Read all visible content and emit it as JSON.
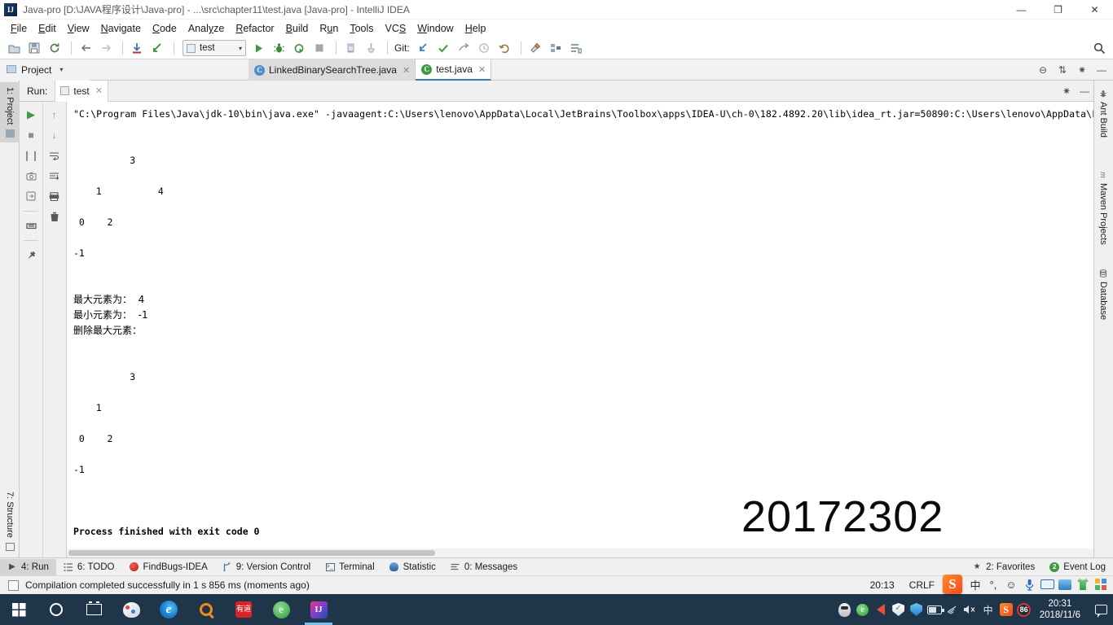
{
  "window": {
    "title": "Java-pro [D:\\JAVA程序设计\\Java-pro] - ...\\src\\chapter11\\test.java [Java-pro] - IntelliJ IDEA",
    "logo": "IJ",
    "buttons": {
      "minimize": "—",
      "maximize": "❐",
      "close": "✕"
    }
  },
  "menu": {
    "items": [
      {
        "label": "File",
        "accel": "F"
      },
      {
        "label": "Edit",
        "accel": "E"
      },
      {
        "label": "View",
        "accel": "V"
      },
      {
        "label": "Navigate",
        "accel": "N"
      },
      {
        "label": "Code",
        "accel": "C"
      },
      {
        "label": "Analyze",
        "accel": "y"
      },
      {
        "label": "Refactor",
        "accel": "R"
      },
      {
        "label": "Build",
        "accel": "B"
      },
      {
        "label": "Run",
        "accel": "u"
      },
      {
        "label": "Tools",
        "accel": "T"
      },
      {
        "label": "VCS",
        "accel": "S"
      },
      {
        "label": "Window",
        "accel": "W"
      },
      {
        "label": "Help",
        "accel": "H"
      }
    ]
  },
  "toolbar": {
    "open_icon": "open-project-icon",
    "save_icon": "save-all-icon",
    "sync_icon": "synchronize-icon",
    "back_icon": "◀",
    "forward_icon": "▶",
    "update_icon": "↓",
    "compile_icon": "◣",
    "run_config": "test",
    "run_icon": "▶",
    "debug_icon": "debug-icon",
    "coverage_icon": "coverage-icon",
    "stop_icon": "■",
    "profile_icon": "profile-icon",
    "attach_icon": "attach-icon",
    "git_label": "Git:",
    "git_update_icon": "↙",
    "git_commit_icon": "✓",
    "git_push_icon": "⤴",
    "git_history_icon": "◷",
    "git_revert_icon": "↺",
    "settings_icon": "⚒",
    "structure_icon": "structure-icon",
    "layout_icon": "layout-icon",
    "search_icon": "🔍"
  },
  "navrow": {
    "project_label": "Project",
    "caret": "▾",
    "collapse_icon": "⊖",
    "flatten_icon": "⇅",
    "gear_icon": "✷",
    "hide_icon": "—"
  },
  "editor_tabs": [
    {
      "label": "LinkedBinarySearchTree.java",
      "icon": "C",
      "close": "✕",
      "active": false
    },
    {
      "label": "test.java",
      "icon": "C",
      "close": "✕",
      "active": true
    }
  ],
  "left_stripe": {
    "top": {
      "label": "1: Project",
      "icon": "folder-icon"
    },
    "bottom": {
      "label": "7: Structure",
      "icon": "structure-icon"
    }
  },
  "right_stripe": [
    {
      "label": "Ant Build",
      "icon": "ant-icon"
    },
    {
      "label": "Maven Projects",
      "icon": "m"
    },
    {
      "label": "Database",
      "icon": "database-icon"
    }
  ],
  "run_window": {
    "label": "Run:",
    "tab": "test",
    "tab_close": "✕",
    "gear_icon": "✷",
    "hide_icon": "—",
    "side_icons_col1": [
      "rerun-icon",
      "stop-icon",
      "pause-icon",
      "thread-dump-icon",
      "restore-layout-icon",
      "print-icon",
      "pin-tab-icon"
    ],
    "side_icons_col2": [
      "up-stacktrace-icon",
      "down-stacktrace-icon",
      "soft-wrap-icon",
      "scroll-to-end-icon",
      "print-console-icon",
      "clear-all-icon"
    ]
  },
  "console": {
    "command_line": "\"C:\\Program Files\\Java\\jdk-10\\bin\\java.exe\" -javaagent:C:\\Users\\lenovo\\AppData\\Local\\JetBrains\\Toolbox\\apps\\IDEA-U\\ch-0\\182.4892.20\\lib\\idea_rt.jar=50890:C:\\Users\\lenovo\\AppData\\L",
    "tree_before": [
      "          3",
      "",
      "    1          4",
      "",
      " 0    2",
      "",
      "-1"
    ],
    "max_label": "最大元素为：",
    "max_value": "4",
    "min_label": "最小元素为：",
    "min_value": "-1",
    "remove_label": "删除最大元素：",
    "tree_after": [
      "          3",
      "",
      "    1",
      "",
      " 0    2",
      "",
      "-1"
    ],
    "exit_line": "Process finished with exit code 0",
    "watermark": "20172302"
  },
  "bottom_stripe": {
    "items": [
      {
        "label": "4: Run",
        "icon": "run-icon",
        "selected": true
      },
      {
        "label": "6: TODO",
        "icon": "todo-icon",
        "selected": false
      },
      {
        "label": "FindBugs-IDEA",
        "icon": "findbugs-icon",
        "selected": false
      },
      {
        "label": "9: Version Control",
        "icon": "version-control-icon",
        "selected": false
      },
      {
        "label": "Terminal",
        "icon": "terminal-icon",
        "selected": false
      },
      {
        "label": "Statistic",
        "icon": "statistic-icon",
        "selected": false
      },
      {
        "label": "0: Messages",
        "icon": "messages-icon",
        "selected": false
      }
    ],
    "right_items": [
      {
        "label": "2: Favorites",
        "icon": "star-icon"
      },
      {
        "label": "Event Log",
        "icon": "event-log-icon",
        "badge": "2"
      }
    ]
  },
  "statusbar": {
    "icon": "event-indicator-icon",
    "message": "Compilation completed successfully in 1 s 856 ms (moments ago)",
    "time": "20:13",
    "line_separator": "CRLF"
  },
  "ime": {
    "logo": "S",
    "mode": "中",
    "punctuation": "°,",
    "emoji": "☺",
    "voice": "voice-input-icon",
    "keyboard": "keyboard-icon",
    "card": "id-card-icon",
    "skin": "skin-icon",
    "toolbox": "toolbox-icon"
  },
  "taskbar": {
    "items": [
      {
        "name": "start-button",
        "icon": "windows-logo-icon"
      },
      {
        "name": "cortana-button",
        "icon": "cortana-circle-icon"
      },
      {
        "name": "task-view-button",
        "icon": "task-view-icon"
      },
      {
        "name": "paint-3d-app",
        "icon": "paint-icon"
      },
      {
        "name": "edge-browser-app",
        "icon": "edge-icon",
        "glyph": "e"
      },
      {
        "name": "search-app",
        "icon": "magnifier-icon"
      },
      {
        "name": "youdao-dictionary-app",
        "icon": "youdao-icon",
        "glyph": "有道"
      },
      {
        "name": "green-browser-app",
        "icon": "browser-icon",
        "glyph": "e"
      },
      {
        "name": "intellij-idea-app",
        "icon": "idea-icon",
        "glyph": "IJ",
        "running": true
      }
    ],
    "tray": [
      {
        "name": "qq-tray-icon",
        "icon": "qq-penguin-icon"
      },
      {
        "name": "browser-tray-icon",
        "icon": "browser-icon",
        "glyph": "e"
      },
      {
        "name": "speaker-tray-icon",
        "icon": "speaker-icon"
      },
      {
        "name": "windows-defender-tray-icon",
        "icon": "shield-check-icon"
      },
      {
        "name": "tencent-security-tray-icon",
        "icon": "shield-icon"
      },
      {
        "name": "battery-tray-icon",
        "icon": "battery-icon"
      },
      {
        "name": "network-tray-icon",
        "icon": "wifi-icon"
      },
      {
        "name": "volume-tray-icon",
        "icon": "volume-mute-icon",
        "glyph": "🔇"
      },
      {
        "name": "ime-mode-tray-icon",
        "icon": "chinese-mode-icon",
        "glyph": "中"
      },
      {
        "name": "sogou-tray-icon",
        "icon": "sogou-icon",
        "glyph": "S"
      },
      {
        "name": "temperature-tray-icon",
        "icon": "circle-badge-icon",
        "glyph": "86"
      }
    ],
    "clock": {
      "time": "20:31",
      "date": "2018/11/6"
    },
    "notification": "notification-icon"
  },
  "colors": {
    "accent": "#3c7cb4",
    "taskbar_bg": "#1f3549",
    "panel_bg": "#f0f0f0",
    "console_bg": "#ffffff",
    "green": "#3d9a43",
    "red": "#d8342a",
    "sogou_orange": "#f24b1e"
  }
}
